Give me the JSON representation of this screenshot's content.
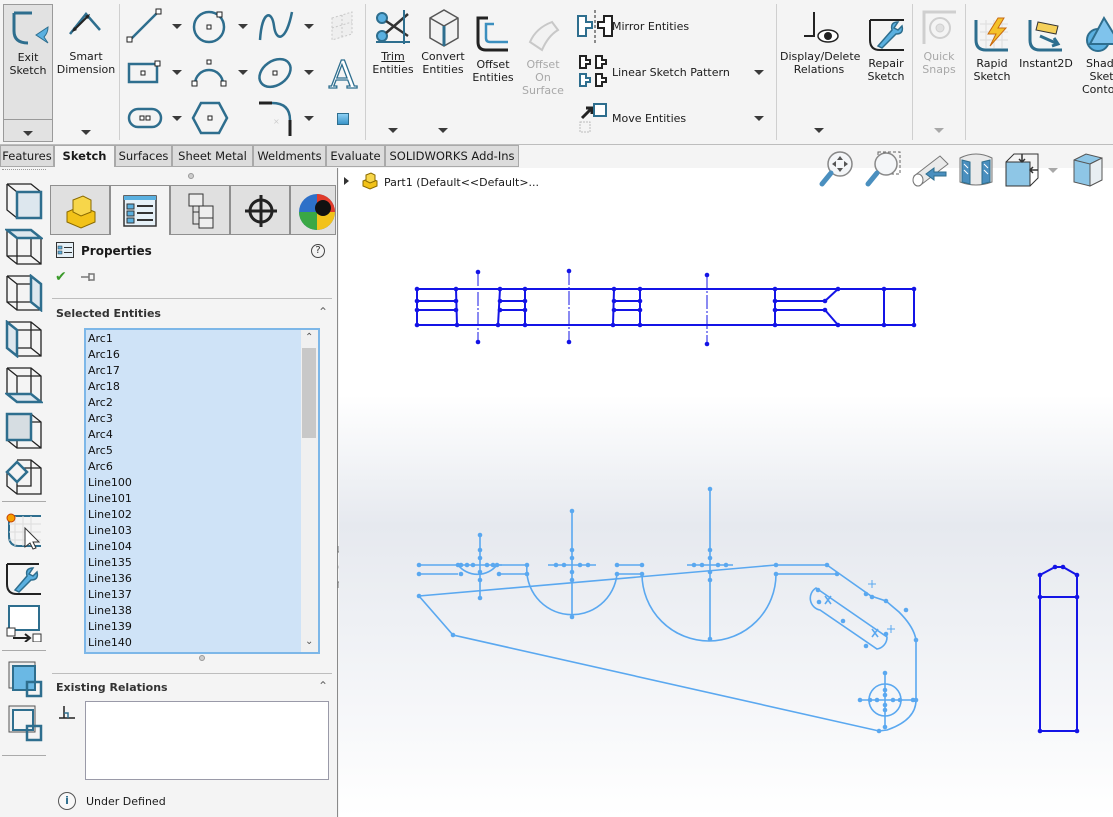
{
  "ribbon": {
    "exit_sketch": "Exit\nSketch",
    "smart_dimension": "Smart\nDimension",
    "trim_entities": [
      "Trim",
      "Entities"
    ],
    "convert_entities": [
      "Convert",
      "Entities"
    ],
    "offset_entities": [
      "Offset",
      "Entities"
    ],
    "offset_on_surface": [
      "Offset",
      "On",
      "Surface"
    ],
    "mirror_entities": "Mirror Entities",
    "linear_sketch_pattern": "Linear Sketch Pattern",
    "move_entities": "Move Entities",
    "display_delete_relations": [
      "Display/Delete",
      "Relations"
    ],
    "repair_sketch": [
      "Repair",
      "Sketch"
    ],
    "quick_snaps": [
      "Quick",
      "Snaps"
    ],
    "rapid_sketch": [
      "Rapid",
      "Sketch"
    ],
    "instant2d": "Instant2D",
    "shaded_sketch_contours": [
      "Shad",
      "Sketc",
      "Conto"
    ]
  },
  "tabs": [
    "Features",
    "Sketch",
    "Surfaces",
    "Sheet Metal",
    "Weldments",
    "Evaluate",
    "SOLIDWORKS Add-Ins"
  ],
  "active_tab": "Sketch",
  "tree": {
    "part_label": "Part1  (Default<<Default>..."
  },
  "property_manager": {
    "title": "Properties",
    "selected_entities_title": "Selected Entities",
    "selected_entities": [
      "Arc1",
      "Arc16",
      "Arc17",
      "Arc18",
      "Arc2",
      "Arc3",
      "Arc4",
      "Arc5",
      "Arc6",
      "Line100",
      "Line101",
      "Line102",
      "Line103",
      "Line104",
      "Line135",
      "Line136",
      "Line137",
      "Line138",
      "Line139",
      "Line140"
    ],
    "existing_relations_title": "Existing Relations",
    "status": "Under Defined"
  },
  "colors": {
    "selected_sketch": "#1414e6",
    "unselected_sketch": "#5aa8f0",
    "list_bg": "#cfe3f7",
    "accent": "#2e6e8e"
  }
}
